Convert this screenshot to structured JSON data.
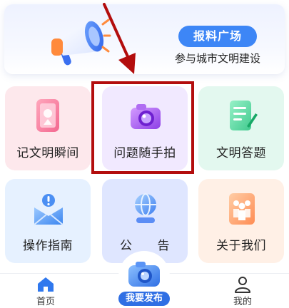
{
  "banner": {
    "badge_label": "报料广场",
    "subtitle": "参与城市文明建设",
    "icon": "megaphone-icon"
  },
  "tiles": [
    {
      "label": "记文明瞬间",
      "icon": "phone-icon",
      "bg": "#fde8ec"
    },
    {
      "label": "问题随手拍",
      "icon": "camera-icon",
      "bg": "#f1e9ff"
    },
    {
      "label": "文明答题",
      "icon": "notepad-icon",
      "bg": "#e3f8ef"
    },
    {
      "label": "操作指南",
      "icon": "envelope-icon",
      "bg": "#e6f1ff"
    },
    {
      "label": "公　　告",
      "icon": "globe-icon",
      "bg": "#dfe6ff"
    },
    {
      "label": "关于我们",
      "icon": "people-icon",
      "bg": "#fff0e6"
    }
  ],
  "tabbar": {
    "home_label": "首页",
    "publish_label": "我要发布",
    "me_label": "我的"
  },
  "colors": {
    "accent": "#3d86f6",
    "highlight_box": "#b30d0d",
    "publish_pill": "#2f6fe4"
  }
}
